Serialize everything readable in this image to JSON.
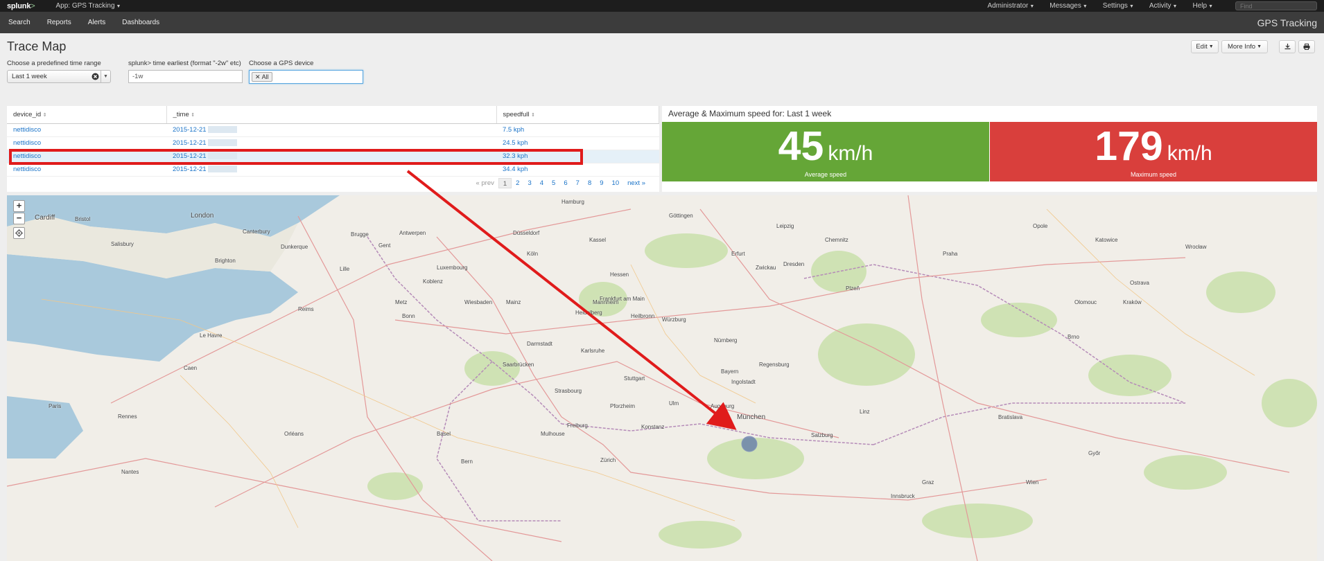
{
  "topbar": {
    "logo": "splunk",
    "logo_suffix": ">",
    "app_menu": "App: GPS Tracking",
    "items": [
      "Administrator",
      "Messages",
      "Settings",
      "Activity",
      "Help"
    ],
    "find_placeholder": "Find"
  },
  "appbar": {
    "nav": [
      "Search",
      "Reports",
      "Alerts",
      "Dashboards"
    ],
    "app_title": "GPS Tracking"
  },
  "dashboard": {
    "title": "Trace Map",
    "edit_label": "Edit",
    "more_info_label": "More Info",
    "export_icon": "download-icon",
    "print_icon": "print-icon"
  },
  "inputs": {
    "time_range": {
      "label": "Choose a predefined time range",
      "value": "Last 1 week"
    },
    "earliest": {
      "label": "splunk> time earliest (format \"-2w\" etc)",
      "value": "-1w"
    },
    "device": {
      "label": "Choose a GPS device",
      "tag": "All"
    }
  },
  "table": {
    "columns": [
      "device_id",
      "_time",
      "speedfull"
    ],
    "rows": [
      {
        "device_id": "nettidisco",
        "time": "2015-12-21",
        "speed": "7.5 kph"
      },
      {
        "device_id": "nettidisco",
        "time": "2015-12-21",
        "speed": "24.5 kph"
      },
      {
        "device_id": "nettidisco",
        "time": "2015-12-21",
        "speed": "32.3 kph"
      },
      {
        "device_id": "nettidisco",
        "time": "2015-12-21",
        "speed": "34.4 kph"
      }
    ],
    "pager": {
      "prev": "« prev",
      "pages": [
        "1",
        "2",
        "3",
        "4",
        "5",
        "6",
        "7",
        "8",
        "9",
        "10"
      ],
      "next": "next »"
    }
  },
  "speed_panel": {
    "title": "Average & Maximum speed for: Last 1 week",
    "average": {
      "value": "45",
      "unit": "km/h",
      "caption": "Average speed",
      "color": "#65a637"
    },
    "maximum": {
      "value": "179",
      "unit": "km/h",
      "caption": "Maximum speed",
      "color": "#d93f3c"
    }
  },
  "map": {
    "zoom_in": "+",
    "zoom_out": "−",
    "cities": [
      "Cardiff",
      "Bristol",
      "London",
      "Canterbury",
      "Salisbury",
      "Brighton",
      "Dunkerque",
      "Lille",
      "Gent",
      "Antwerpen",
      "Brugge",
      "Düsseldorf",
      "Köln",
      "Hamburg",
      "Leipzig",
      "Göttingen",
      "Frankfurt am Main",
      "Hessen",
      "Würzburg",
      "Nürnberg",
      "Bayern",
      "Regensburg",
      "Ingolstadt",
      "Augsburg",
      "München",
      "Stuttgart",
      "Strasbourg",
      "Zürich",
      "Mulhouse",
      "Freiburg",
      "Ulm",
      "Paris",
      "Rennes",
      "Nantes",
      "Orléans",
      "Le Havre",
      "Caen",
      "Reims",
      "Metz",
      "Luxembourg",
      "Saarbrücken",
      "Karlsruhe",
      "Mannheim",
      "Heilbronn",
      "Praha",
      "Plzeň",
      "Kraków",
      "Brno",
      "Bratislava",
      "Salzburg",
      "Linz",
      "Wien",
      "Graz",
      "Győr",
      "Wrocław",
      "Opole",
      "Katowice",
      "Ostrava",
      "Olomouc",
      "Dresden",
      "Chemnitz",
      "Zwickau",
      "Kassel",
      "Erfurt",
      "Bonn",
      "Koblenz",
      "Mainz",
      "Wiesbaden",
      "Darmstadt",
      "Heidelberg",
      "Pforzheim",
      "Innsbruck",
      "Konstanz",
      "Basel",
      "Bern"
    ]
  }
}
